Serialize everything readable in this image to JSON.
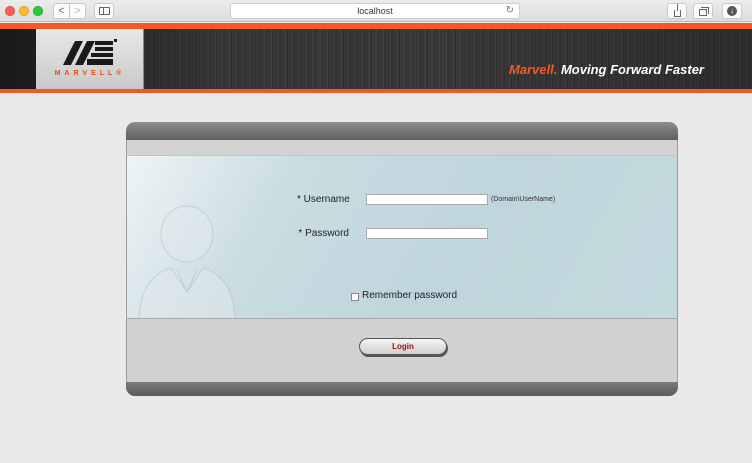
{
  "browser": {
    "url": "localhost",
    "reload_glyph": "↻",
    "back_glyph": "<",
    "forward_glyph": ">",
    "download_glyph": "↓"
  },
  "header": {
    "logo_text": "MARVELL®",
    "tagline_brand": "Marvell.",
    "tagline_text": " Moving Forward Faster",
    "accent_color": "#f15a24"
  },
  "login": {
    "username_label": "* Username",
    "username_hint": "(Domain\\UserName)",
    "username_value": "",
    "password_label": "* Password",
    "password_value": "",
    "remember_label": "Remember password",
    "remember_checked": false,
    "login_button": "Login"
  }
}
